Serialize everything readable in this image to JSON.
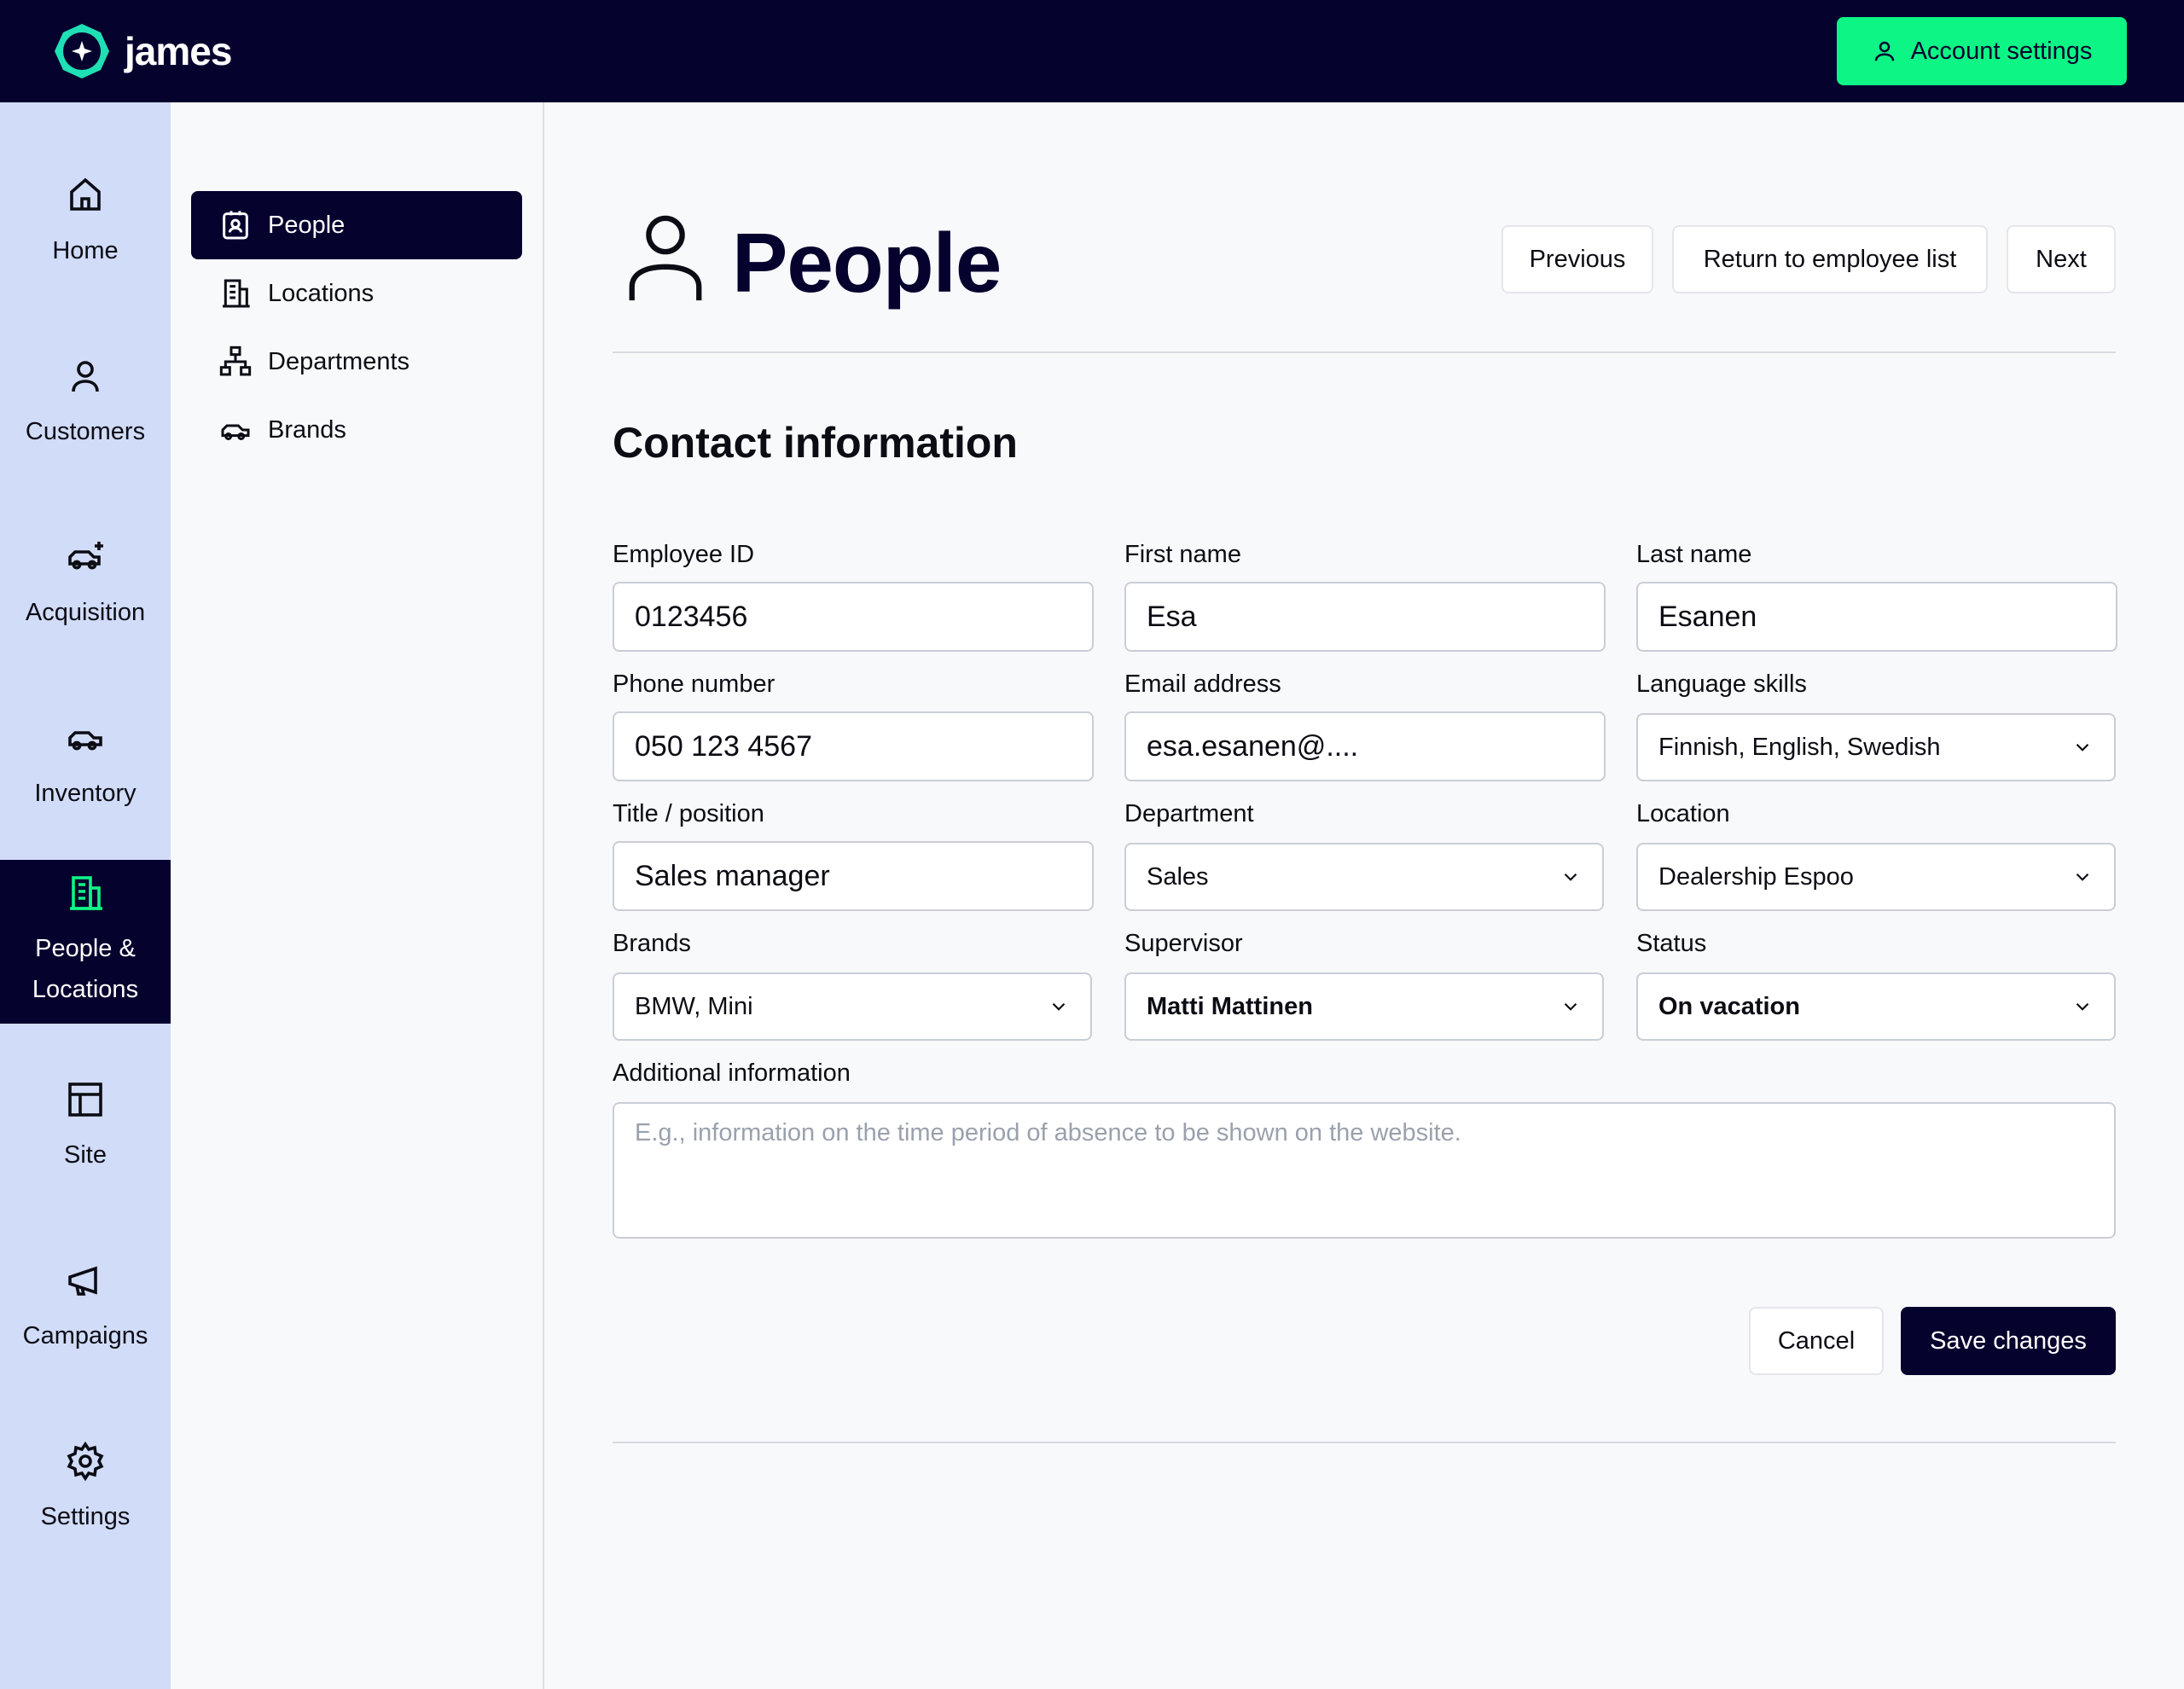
{
  "topbar": {
    "brand": "james",
    "account_button": "Account settings"
  },
  "rail": {
    "items": [
      {
        "label": "Home",
        "icon": "home-icon"
      },
      {
        "label": "Customers",
        "icon": "user-icon"
      },
      {
        "label": "Acquisition",
        "icon": "car-plus-icon"
      },
      {
        "label": "Inventory",
        "icon": "car-icon"
      },
      {
        "label": "People & Locations",
        "icon": "building-icon",
        "active": true
      },
      {
        "label": "Site",
        "icon": "layout-icon"
      },
      {
        "label": "Campaigns",
        "icon": "megaphone-icon"
      },
      {
        "label": "Settings",
        "icon": "gear-icon"
      }
    ]
  },
  "subnav": {
    "items": [
      {
        "label": "People",
        "icon": "id-badge-icon",
        "active": true
      },
      {
        "label": "Locations",
        "icon": "building-icon"
      },
      {
        "label": "Departments",
        "icon": "hierarchy-icon"
      },
      {
        "label": "Brands",
        "icon": "car-icon"
      }
    ]
  },
  "page": {
    "title": "People",
    "previous": "Previous",
    "return": "Return to employee list",
    "next": "Next"
  },
  "form": {
    "section_title": "Contact information",
    "employee_id": {
      "label": "Employee ID",
      "value": "0123456"
    },
    "first_name": {
      "label": "First name",
      "value": "Esa"
    },
    "last_name": {
      "label": "Last name",
      "value": "Esanen"
    },
    "phone": {
      "label": "Phone number",
      "value": "050 123 4567"
    },
    "email": {
      "label": "Email address",
      "value": "esa.esanen@...."
    },
    "languages": {
      "label": "Language skills",
      "value": "Finnish, English, Swedish"
    },
    "title": {
      "label": "Title / position",
      "value": "Sales manager"
    },
    "department": {
      "label": "Department",
      "value": "Sales"
    },
    "location": {
      "label": "Location",
      "value": "Dealership Espoo"
    },
    "brands": {
      "label": "Brands",
      "value": "BMW, Mini"
    },
    "supervisor": {
      "label": "Supervisor",
      "value": "Matti Mattinen"
    },
    "status": {
      "label": "Status",
      "value": "On vacation"
    },
    "additional": {
      "label": "Additional information",
      "placeholder": "E.g., information on the time period of absence to be shown on the website."
    },
    "cancel": "Cancel",
    "save": "Save changes"
  },
  "colors": {
    "navy": "#06022e",
    "accent_green": "#0df585",
    "rail_bg": "#d1dcf8",
    "page_bg": "#f8f9fb"
  }
}
